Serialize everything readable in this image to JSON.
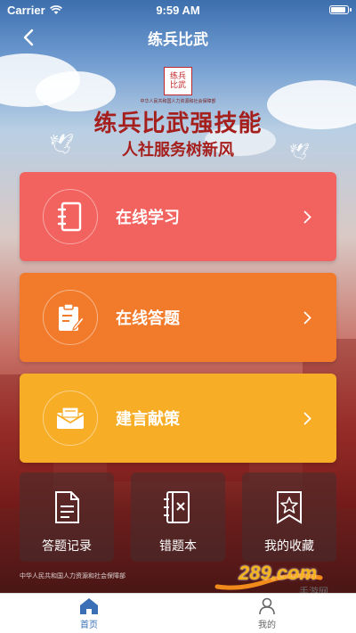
{
  "status_bar": {
    "carrier": "Carrier",
    "time": "9:59 AM"
  },
  "nav": {
    "title": "练兵比武",
    "back_icon": "chevron-left-icon"
  },
  "banner": {
    "seal_text": "练兵比武",
    "seal_caption": "中华人民共和国人力资源和社会保障部",
    "slogan_line1": "练兵比武强技能",
    "slogan_line2": "人社服务树新风"
  },
  "menu_cards": [
    {
      "label": "在线学习",
      "icon": "notebook-icon",
      "color": "#f2625e"
    },
    {
      "label": "在线答题",
      "icon": "clipboard-edit-icon",
      "color": "#f27a2b"
    },
    {
      "label": "建言献策",
      "icon": "envelope-icon",
      "color": "#f8ad27"
    }
  ],
  "tiles": [
    {
      "label": "答题记录",
      "icon": "document-icon"
    },
    {
      "label": "错题本",
      "icon": "error-book-icon"
    },
    {
      "label": "我的收藏",
      "icon": "star-bookmark-icon"
    }
  ],
  "footer_caption": "中华人民共和国人力资源和社会保障部",
  "watermark": {
    "brand": "289.com",
    "subtitle": "手游网"
  },
  "tabbar": [
    {
      "label": "首页",
      "icon": "home-icon",
      "active": true,
      "color": "#3a6fb5"
    },
    {
      "label": "我的",
      "icon": "user-icon",
      "active": false,
      "color": "#666666"
    }
  ]
}
